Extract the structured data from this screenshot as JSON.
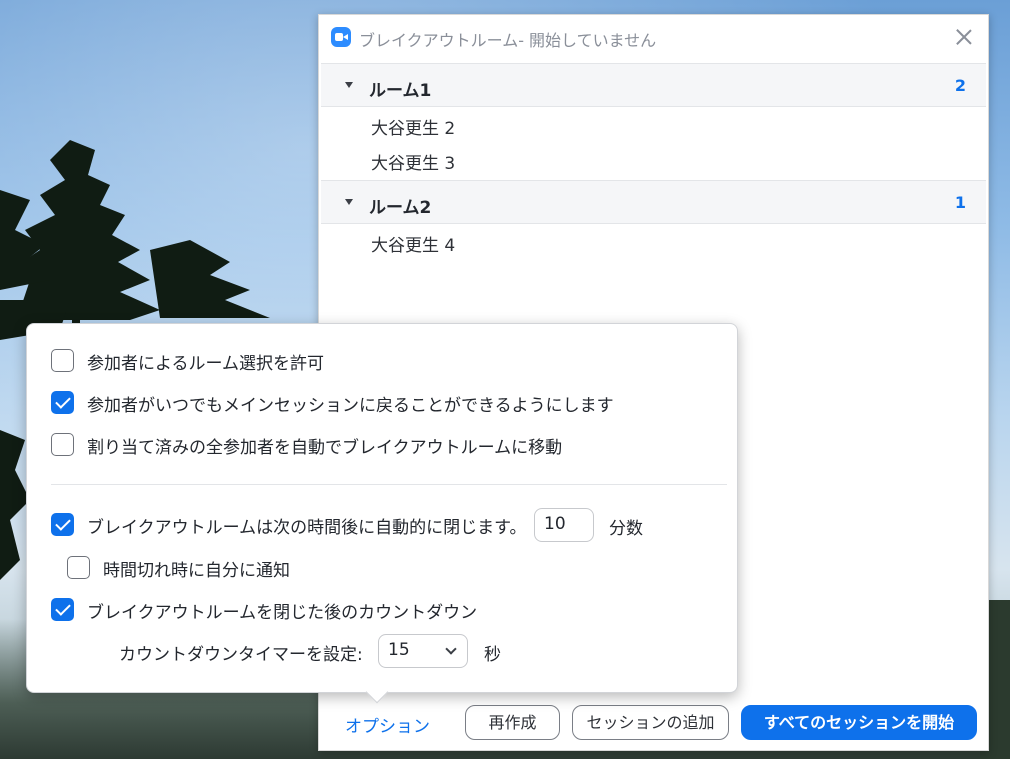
{
  "window": {
    "title": "ブレイクアウトルーム- 開始していません"
  },
  "rooms": [
    {
      "name": "ルーム1",
      "count": "2",
      "participants": [
        "大谷更生 2",
        "大谷更生 3"
      ]
    },
    {
      "name": "ルーム2",
      "count": "1",
      "participants": [
        "大谷更生 4"
      ]
    }
  ],
  "footer": {
    "options_label": "オプション",
    "recreate_label": "再作成",
    "add_session_label": "セッションの追加",
    "start_all_label": "すべてのセッションを開始"
  },
  "options": {
    "allow_choose_room": {
      "label": "参加者によるルーム選択を許可",
      "checked": false
    },
    "allow_return_main": {
      "label": "参加者がいつでもメインセッションに戻ることができるようにします",
      "checked": true
    },
    "auto_move": {
      "label": "割り当て済みの全参加者を自動でブレイクアウトルームに移動",
      "checked": false
    },
    "auto_close": {
      "label": "ブレイクアウトルームは次の時間後に自動的に閉じます。",
      "checked": true,
      "value": "10",
      "unit": "分数"
    },
    "notify_timeout": {
      "label": "時間切れ時に自分に通知",
      "checked": false
    },
    "countdown": {
      "label": "ブレイクアウトルームを閉じた後のカウントダウン",
      "checked": true
    },
    "countdown_timer": {
      "label": "カウントダウンタイマーを設定:",
      "value": "15",
      "unit": "秒"
    }
  },
  "colors": {
    "accent": "#0e71eb",
    "room_header_bg": "#f5f6f8"
  }
}
